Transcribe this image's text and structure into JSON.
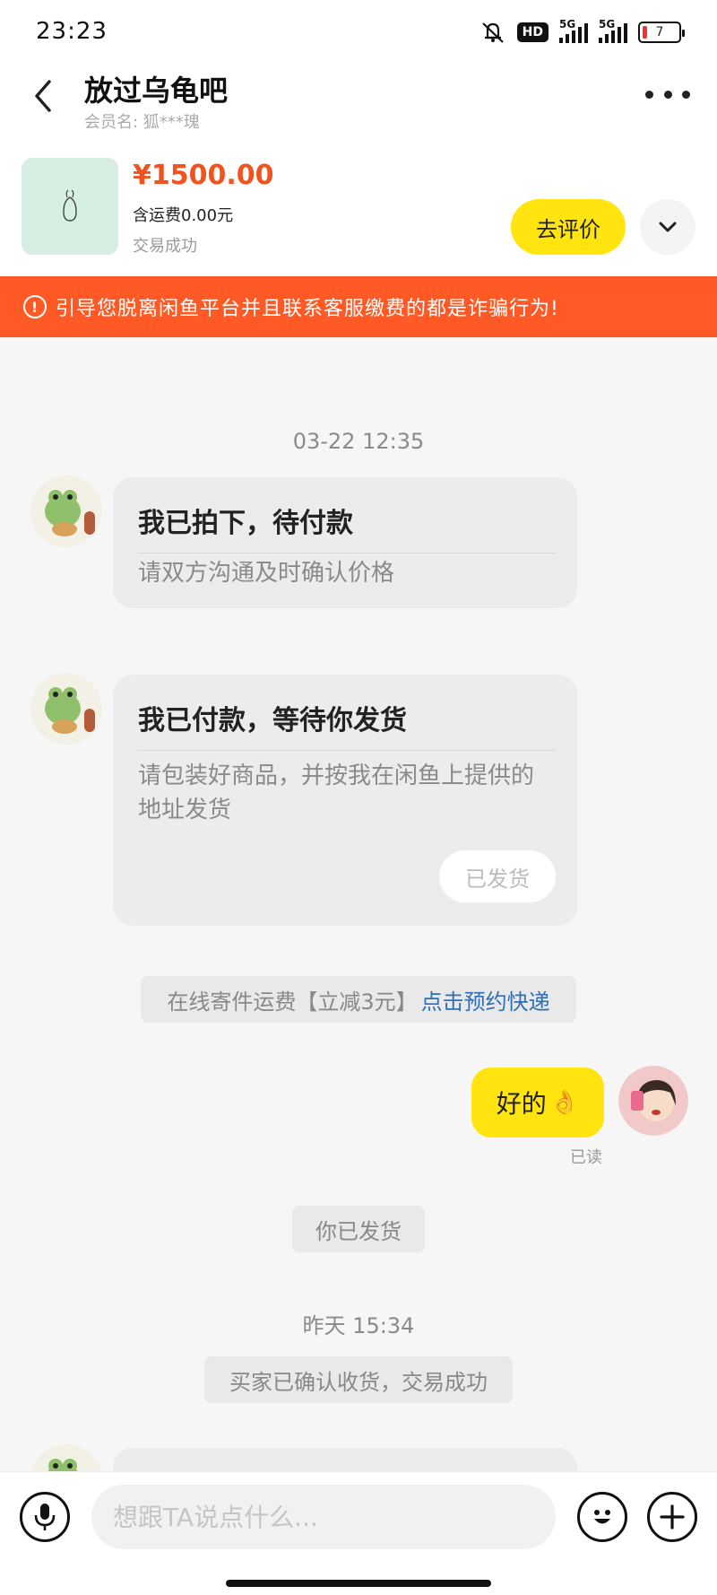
{
  "status_bar": {
    "time": "23:23",
    "hd_label": "HD",
    "network_1": "5G",
    "network_2": "5G",
    "battery_level": "7"
  },
  "header": {
    "title": "放过乌龟吧",
    "member_label": "会员名: 狐***瑰"
  },
  "product": {
    "price": "¥1500.00",
    "shipping": "含运费0.00元",
    "status": "交易成功",
    "review_label": "去评价"
  },
  "warning": {
    "text": "引导您脱离闲鱼平台并且联系客服缴费的都是诈骗行为!"
  },
  "chat": {
    "time_1": "03-22 12:35",
    "card_1": {
      "title": "我已拍下，待付款",
      "body": "请双方沟通及时确认价格"
    },
    "card_2": {
      "title": "我已付款，等待你发货",
      "body": "请包装好商品，并按我在闲鱼上提供的地址发货",
      "button": "已发货"
    },
    "shipping_promo": {
      "text": "在线寄件运费【立减3元】",
      "link": "点击预约快递"
    },
    "my_message": {
      "text": "好的",
      "emoji": "👌",
      "read": "已读"
    },
    "notice_shipped": "你已发货",
    "time_2": "昨天 15:34",
    "notice_confirmed": "买家已确认收货，交易成功"
  },
  "input_bar": {
    "placeholder": "想跟TA说点什么..."
  },
  "colors": {
    "accent_yellow": "#ffe40f",
    "price_orange": "#f0531f",
    "warning_bg": "#ff5a26",
    "link_blue": "#2f6fb4"
  }
}
